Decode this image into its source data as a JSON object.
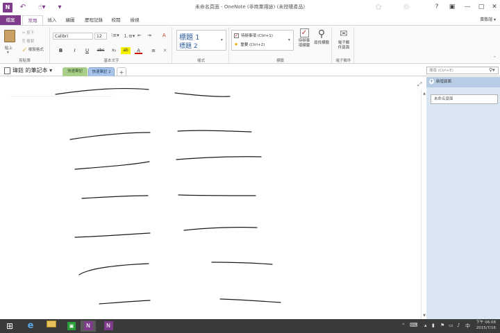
{
  "window": {
    "title": "未命名頁面 - OneNote (非商業用途) (未授權產品)",
    "help": "?",
    "minimize": "—",
    "maximize": "□",
    "close": "✕"
  },
  "app_icon": "N",
  "qat": {
    "back": "↶",
    "touch": "☝▾",
    "more": "▾"
  },
  "tabs": [
    {
      "label": "檔案"
    },
    {
      "label": "常用"
    },
    {
      "label": "插入"
    },
    {
      "label": "繪圖"
    },
    {
      "label": "歷程記錄"
    },
    {
      "label": "校閱"
    },
    {
      "label": "檢視"
    }
  ],
  "user": "黃敬諠 ▾",
  "ribbon": {
    "clipboard": {
      "paste": "貼上",
      "cut": "剪下",
      "copy": "複製",
      "format_painter": "複製格式",
      "group_label": "剪貼簿"
    },
    "basic_text": {
      "font": "Calibri",
      "size": "12",
      "bold": "B",
      "italic": "I",
      "underline": "U",
      "strike": "abc",
      "subscript": "x₂",
      "highlight": "ab",
      "font_color": "A",
      "align": "≡",
      "clear": "A",
      "group_label": "基本文字"
    },
    "styles": {
      "heading1": "標題 1",
      "heading2": "標題 2",
      "group_label": "樣式"
    },
    "tags": {
      "todo": "待辦事項 (Ctrl+1)",
      "important": "重要 (Ctrl+2)",
      "todo_tag": "待辦事\n項標籤",
      "find_tags": "尋找標籤",
      "group_label": "標籤"
    },
    "email": {
      "email_page": "電子郵\n件頁面",
      "group_label": "電子郵件"
    }
  },
  "notebook": {
    "name": "瑋鈺 的筆記本",
    "sections": [
      {
        "label": "快速筆記"
      },
      {
        "label": "快速筆記 2"
      }
    ],
    "add_section": "+"
  },
  "search": {
    "placeholder": "搜尋 (Ctrl+E)"
  },
  "pages_pane": {
    "add_page": "新增頁面",
    "pages": [
      {
        "label": "未命名頁面"
      }
    ]
  },
  "taskbar": {
    "apps": [
      "Start",
      "Internet Explorer",
      "File Explorer",
      "Store",
      "OneNote",
      "OneNote 2"
    ],
    "ime": "中",
    "time": "下午 06:08",
    "date": "2015/7/16"
  },
  "colors": {
    "brand": "#7d3b8a",
    "pages_pane": "#dbe6f3",
    "section1": "#a9cf8a",
    "section2": "#a8c4e8",
    "ink": "#1a1a1a"
  }
}
